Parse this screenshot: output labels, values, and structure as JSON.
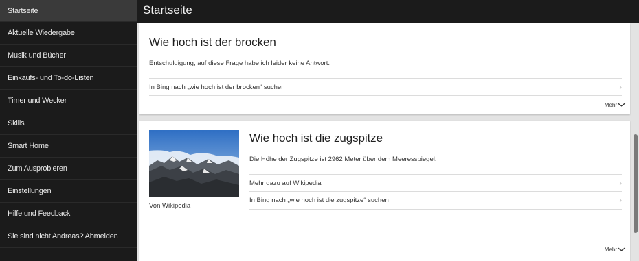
{
  "sidebar": {
    "items": [
      {
        "label": "Startseite"
      },
      {
        "label": "Aktuelle Wiedergabe"
      },
      {
        "label": "Musik und Bücher"
      },
      {
        "label": "Einkaufs- und To-do-Listen"
      },
      {
        "label": "Timer und Wecker"
      },
      {
        "label": "Skills"
      },
      {
        "label": "Smart Home"
      },
      {
        "label": "Zum Ausprobieren"
      },
      {
        "label": "Einstellungen"
      },
      {
        "label": "Hilfe und Feedback"
      },
      {
        "label": "Sie sind nicht Andreas? Abmelden"
      }
    ]
  },
  "header": {
    "title": "Startseite"
  },
  "card1": {
    "title": "Wie hoch ist der brocken",
    "answer": "Entschuldigung, auf diese Frage habe ich leider keine Antwort.",
    "bing_link": "In Bing nach „wie hoch ist der brocken“ suchen",
    "more_label": "Mehr"
  },
  "card2": {
    "title": "Wie hoch ist die zugspitze",
    "answer": "Die Höhe der Zugspitze ist 2962 Meter über dem Meeresspiegel.",
    "wiki_link": "Mehr dazu auf Wikipedia",
    "bing_link": "In Bing nach „wie hoch ist die zugspitze“ suchen",
    "image_caption": "Von Wikipedia",
    "more_label": "Mehr"
  },
  "icons": {
    "chevron_right": "›",
    "chevron_down": "⌄"
  }
}
